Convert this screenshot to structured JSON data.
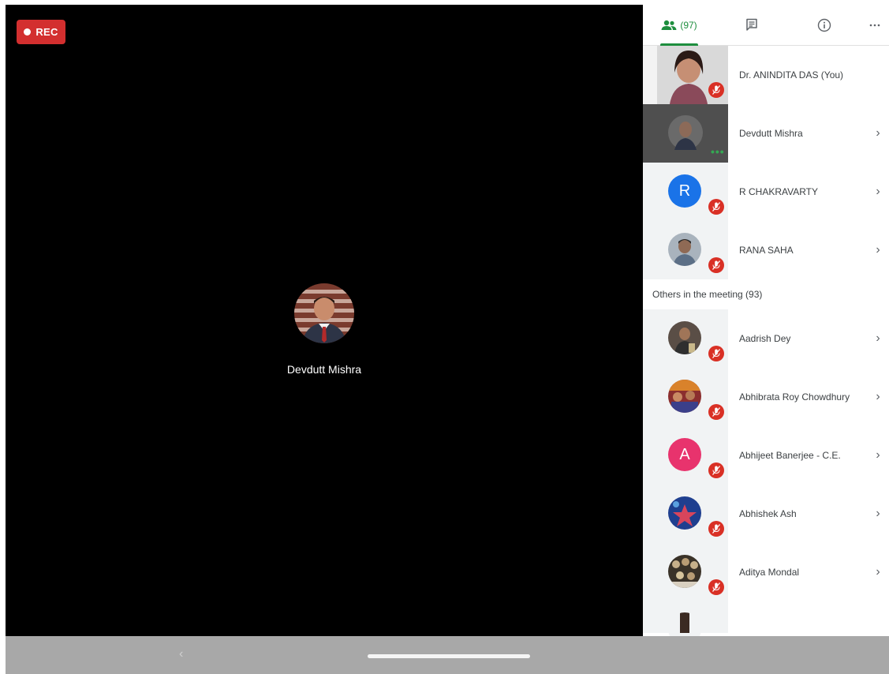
{
  "recording": {
    "label": "REC"
  },
  "stage": {
    "speaker_name": "Devdutt Mishra"
  },
  "panel": {
    "tabs": {
      "people_count": "(97)",
      "people_icon": "people-icon",
      "chat_icon": "chat-icon",
      "info_icon": "info-icon",
      "more_icon": "more-icon"
    },
    "pinned": [
      {
        "name": "Dr. ANINDITA DAS (You)",
        "muted": true
      },
      {
        "name": "Devdutt Mishra",
        "speaking": true
      },
      {
        "name": "R CHAKRAVARTY",
        "initial": "R",
        "avatar_color": "#1a73e8",
        "muted": true
      },
      {
        "name": "RANA SAHA",
        "muted": true
      }
    ],
    "others_label": "Others in the meeting (93)",
    "others": [
      {
        "name": "Aadrish Dey",
        "muted": true
      },
      {
        "name": "Abhibrata Roy Chowdhury",
        "muted": true
      },
      {
        "name": "Abhijeet Banerjee - C.E.",
        "initial": "A",
        "avatar_color": "#e8336d",
        "muted": true
      },
      {
        "name": "Abhishek Ash",
        "muted": true
      },
      {
        "name": "Aditya Mondal",
        "muted": true
      }
    ]
  },
  "colors": {
    "accent": "#1e8e3e",
    "mute": "#d93025",
    "rec": "#d32f2f"
  }
}
